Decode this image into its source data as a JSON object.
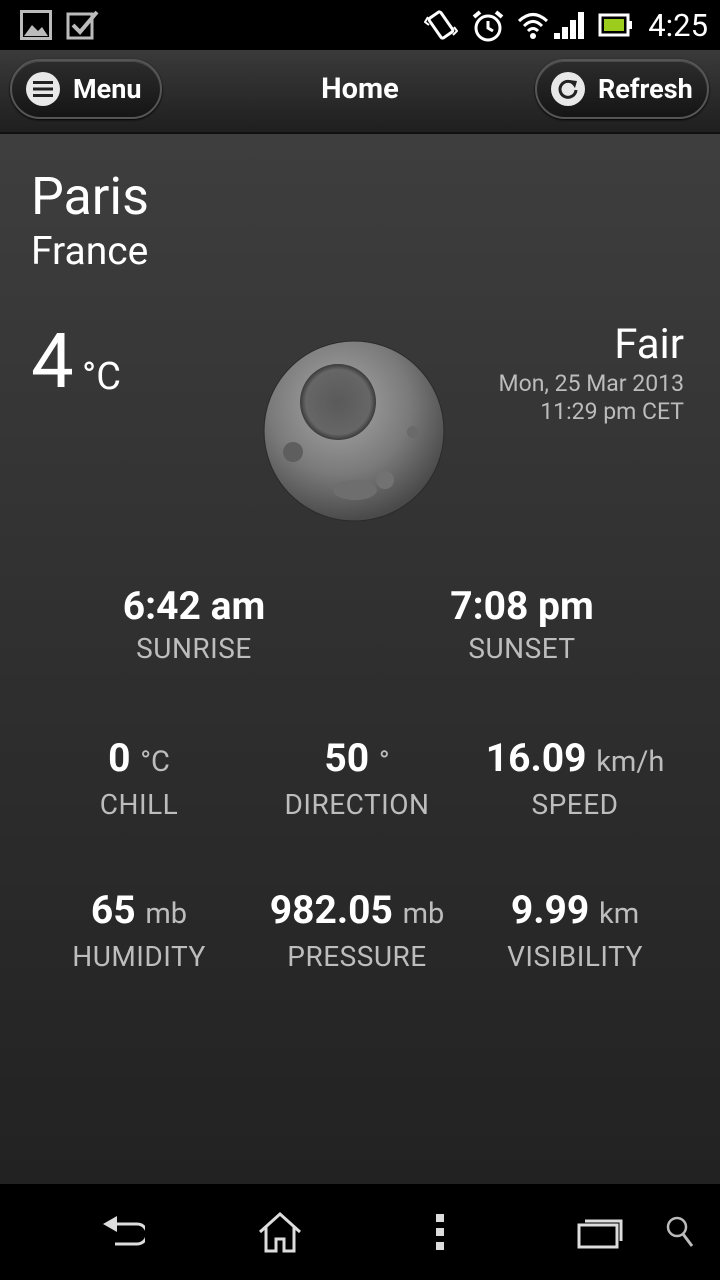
{
  "status": {
    "time": "4:25"
  },
  "actionbar": {
    "menu_label": "Menu",
    "title": "Home",
    "refresh_label": "Refresh"
  },
  "location": {
    "city": "Paris",
    "country": "France"
  },
  "current": {
    "temperature": "4",
    "temp_unit": "°C",
    "condition": "Fair",
    "date": "Mon, 25 Mar 2013",
    "time": "11:29 pm CET",
    "icon": "moon-icon"
  },
  "sun": {
    "sunrise": {
      "value": "6:42 am",
      "label": "SUNRISE"
    },
    "sunset": {
      "value": "7:08 pm",
      "label": "SUNSET"
    }
  },
  "wind": {
    "chill": {
      "value": "0",
      "unit": "°C",
      "label": "CHILL"
    },
    "direction": {
      "value": "50",
      "unit": "°",
      "label": "DIRECTION"
    },
    "speed": {
      "value": "16.09",
      "unit": "km/h",
      "label": "SPEED"
    }
  },
  "atmosphere": {
    "humidity": {
      "value": "65",
      "unit": "mb",
      "label": "HUMIDITY"
    },
    "pressure": {
      "value": "982.05",
      "unit": "mb",
      "label": "PRESSURE"
    },
    "visibility": {
      "value": "9.99",
      "unit": "km",
      "label": "VISIBILITY"
    }
  }
}
